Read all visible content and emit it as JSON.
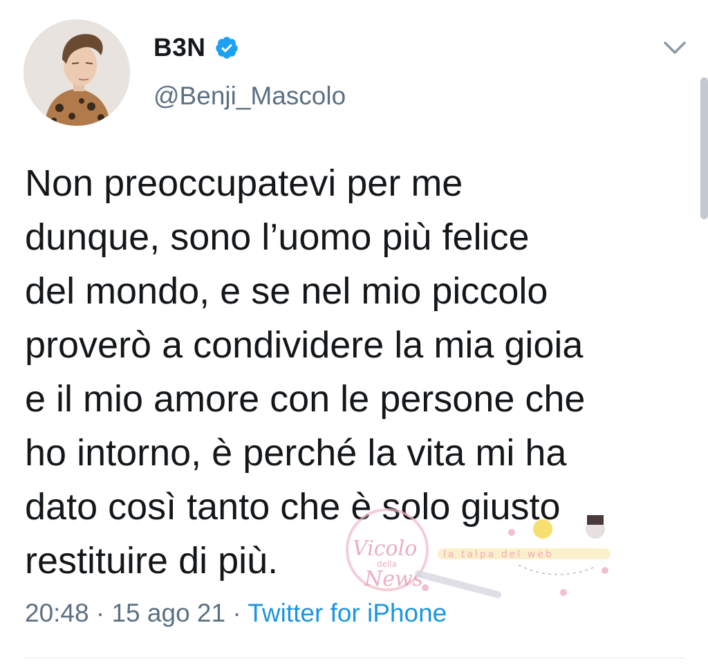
{
  "author": {
    "display_name": "B3N",
    "handle": "@Benji_Mascolo",
    "verified_icon": "verified-badge-icon",
    "avatar_icon": "profile-avatar"
  },
  "tweet": {
    "text": "Non preoccupatevi per me\ndunque, sono l’uomo più felice\ndel mondo, e se nel mio piccolo\nproverò a condividere la mia gioia\ne il mio amore con le persone che\nho intorno, è perché la vita mi ha\ndato così tanto che è solo giusto\nrestituire di più.",
    "time": "20:48",
    "date": "15 ago 21",
    "separator": " · ",
    "source": "Twitter for iPhone"
  },
  "watermark": {
    "logo_text": "Vicolo della News",
    "secondary_text": "la talpa del web"
  },
  "colors": {
    "text": "#14171a",
    "secondary": "#5b7083",
    "link": "#1b95e0",
    "verified": "#1da1f2",
    "divider": "#e1e8ed"
  }
}
